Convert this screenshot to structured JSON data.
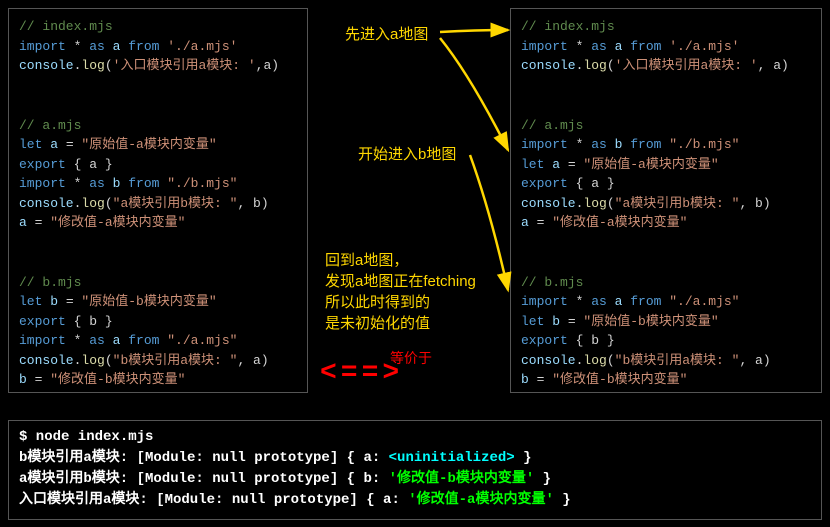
{
  "left": {
    "c1": "// index.mjs",
    "l1a": "import",
    "l1b": " * ",
    "l1c": "as",
    "l1d": " a ",
    "l1e": "from",
    "l1f": " './a.mjs'",
    "l2a": "console",
    "l2b": ".",
    "l2c": "log",
    "l2d": "(",
    "l2e": "'入口模块引用a模块: '",
    "l2f": ",a)",
    "c2": "// a.mjs",
    "l3a": "let",
    "l3b": " a ",
    "l3c": "= ",
    "l3d": "\"原始值-a模块内变量\"",
    "l4a": "export",
    "l4b": " { a }",
    "l5a": "import",
    "l5b": " * ",
    "l5c": "as",
    "l5d": " b ",
    "l5e": "from",
    "l5f": " \"./b.mjs\"",
    "l6a": "console",
    "l6b": ".",
    "l6c": "log",
    "l6d": "(",
    "l6e": "\"a模块引用b模块: \"",
    "l6f": ", b)",
    "l7a": "a ",
    "l7b": "= ",
    "l7c": "\"修改值-a模块内变量\"",
    "c3": "// b.mjs",
    "l8a": "let",
    "l8b": " b ",
    "l8c": "= ",
    "l8d": "\"原始值-b模块内变量\"",
    "l9a": "export",
    "l9b": " { b }",
    "l10a": "import",
    "l10b": " * ",
    "l10c": "as",
    "l10d": " a ",
    "l10e": "from",
    "l10f": " \"./a.mjs\"",
    "l11a": "console",
    "l11b": ".",
    "l11c": "log",
    "l11d": "(",
    "l11e": "\"b模块引用a模块: \"",
    "l11f": ", a)",
    "l12a": "b ",
    "l12b": "= ",
    "l12c": "\"修改值-b模块内变量\""
  },
  "right": {
    "c1": "// index.mjs",
    "l1a": "import",
    "l1b": " * ",
    "l1c": "as",
    "l1d": " a ",
    "l1e": "from",
    "l1f": " './a.mjs'",
    "l2a": "console",
    "l2b": ".",
    "l2c": "log",
    "l2d": "(",
    "l2e": "'入口模块引用a模块: '",
    "l2f": ", a)",
    "c2": "// a.mjs",
    "l5a": "import",
    "l5b": " * ",
    "l5c": "as",
    "l5d": " b ",
    "l5e": "from",
    "l5f": " \"./b.mjs\"",
    "l3a": "let",
    "l3b": " a ",
    "l3c": "= ",
    "l3d": "\"原始值-a模块内变量\"",
    "l4a": "export",
    "l4b": " { a }",
    "l6a": "console",
    "l6b": ".",
    "l6c": "log",
    "l6d": "(",
    "l6e": "\"a模块引用b模块: \"",
    "l6f": ", b)",
    "l7a": "a ",
    "l7b": "= ",
    "l7c": "\"修改值-a模块内变量\"",
    "c3": "// b.mjs",
    "l10a": "import",
    "l10b": " * ",
    "l10c": "as",
    "l10d": " a ",
    "l10e": "from",
    "l10f": " \"./a.mjs\"",
    "l8a": "let",
    "l8b": " b ",
    "l8c": "= ",
    "l8d": "\"原始值-b模块内变量\"",
    "l9a": "export",
    "l9b": " { b }",
    "l11a": "console",
    "l11b": ".",
    "l11c": "log",
    "l11d": "(",
    "l11e": "\"b模块引用a模块: \"",
    "l11f": ", a)",
    "l12a": "b ",
    "l12b": "= ",
    "l12c": "\"修改值-b模块内变量\""
  },
  "annot": {
    "a1": "先进入a地图",
    "a2": "开始进入b地图",
    "a3_l1": "回到a地图，",
    "a3_l2": "发现a地图正在fetching",
    "a3_l3": "所以此时得到的",
    "a3_l4": "是未初始化的值",
    "eq_label": "等价于",
    "eq_arrow": "<==>"
  },
  "output": {
    "cmd": "$ node index.mjs",
    "r1a": "b模块引用a模块:  [Module: null prototype] { a: ",
    "r1b": "<uninitialized>",
    "r1c": " }",
    "r2a": "a模块引用b模块:  [Module: null prototype] { b: ",
    "r2b": "'修改值-b模块内变量'",
    "r2c": " }",
    "r3a": "入口模块引用a模块:  [Module: null prototype] { a: ",
    "r3b": "'修改值-a模块内变量'",
    "r3c": " }"
  }
}
